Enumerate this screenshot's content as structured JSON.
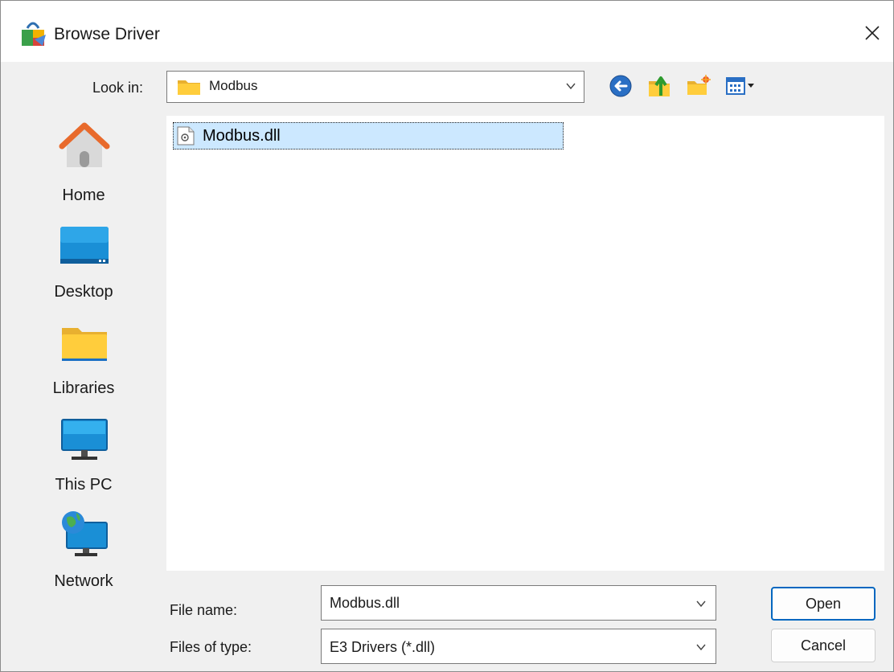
{
  "window": {
    "title": "Browse Driver",
    "app_icon": "shopping-bag-app-icon",
    "close_icon": "close-icon"
  },
  "look_in": {
    "label": "Look in:",
    "value": "Modbus",
    "folder_icon": "folder-icon"
  },
  "toolbar": {
    "back_icon": "back-arrow-icon",
    "up_icon": "up-folder-icon",
    "new_folder_icon": "new-folder-icon",
    "view_menu_icon": "view-menu-icon"
  },
  "places": [
    {
      "label": "Home",
      "icon": "home-icon"
    },
    {
      "label": "Desktop",
      "icon": "desktop-icon"
    },
    {
      "label": "Libraries",
      "icon": "libraries-folder-icon"
    },
    {
      "label": "This PC",
      "icon": "computer-monitor-icon"
    },
    {
      "label": "Network",
      "icon": "network-globe-icon"
    }
  ],
  "files": [
    {
      "name": "Modbus.dll",
      "icon": "dll-file-icon",
      "selected": true
    }
  ],
  "file_name": {
    "label": "File name:",
    "value": "Modbus.dll"
  },
  "file_type": {
    "label": "Files of type:",
    "value": "E3 Drivers (*.dll)"
  },
  "buttons": {
    "open": "Open",
    "cancel": "Cancel"
  },
  "colors": {
    "accent": "#0067c0",
    "selection": "#cce8ff",
    "dialog_bg": "#f0f0f0"
  }
}
